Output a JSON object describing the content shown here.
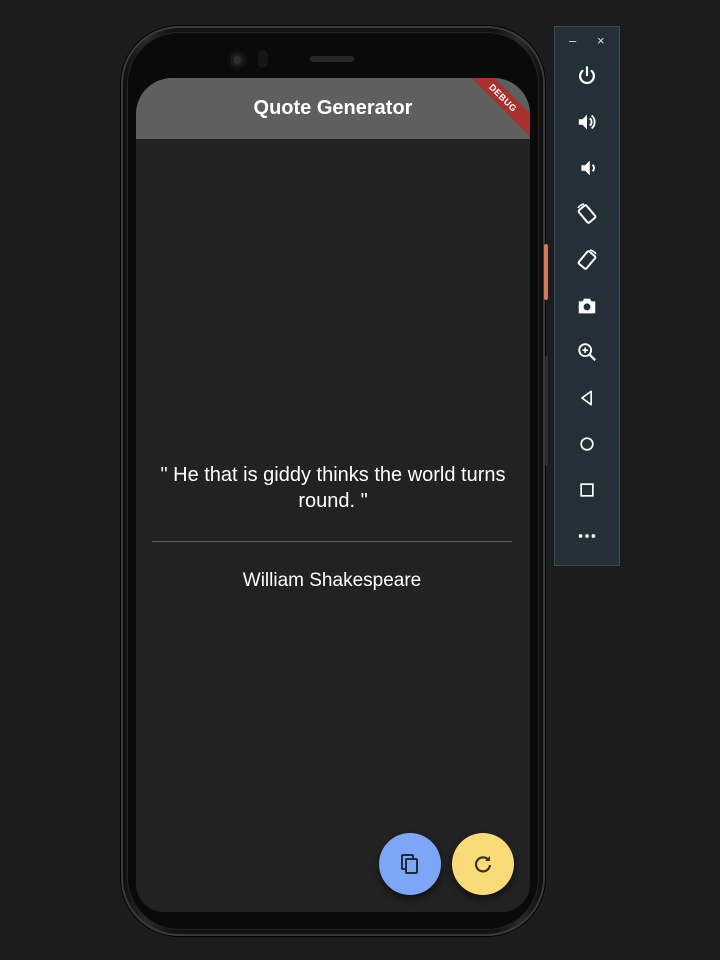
{
  "app": {
    "title": "Quote Generator",
    "debug_banner": "DEBUG"
  },
  "quote": {
    "text": "\" He that is giddy thinks the world turns round. \"",
    "author": "William Shakespeare"
  },
  "fabs": [
    {
      "name": "copy",
      "icon": "copy-icon",
      "color": "#7ea6f6"
    },
    {
      "name": "refresh",
      "icon": "refresh-icon",
      "color": "#f9dc79"
    }
  ],
  "emulator_toolbar": {
    "minimize": "–",
    "close": "×",
    "buttons": [
      {
        "icon": "power-icon"
      },
      {
        "icon": "volume-up-icon"
      },
      {
        "icon": "volume-down-icon"
      },
      {
        "icon": "rotate-left-icon"
      },
      {
        "icon": "rotate-right-icon"
      },
      {
        "icon": "camera-icon"
      },
      {
        "icon": "zoom-icon"
      },
      {
        "icon": "back-icon"
      },
      {
        "icon": "home-icon"
      },
      {
        "icon": "overview-icon"
      },
      {
        "icon": "more-icon"
      }
    ]
  },
  "colors": {
    "app_bar": "#5f5f5f",
    "background": "#222222",
    "divider": "#6a5a47",
    "debug_ribbon": "#a8312f"
  }
}
